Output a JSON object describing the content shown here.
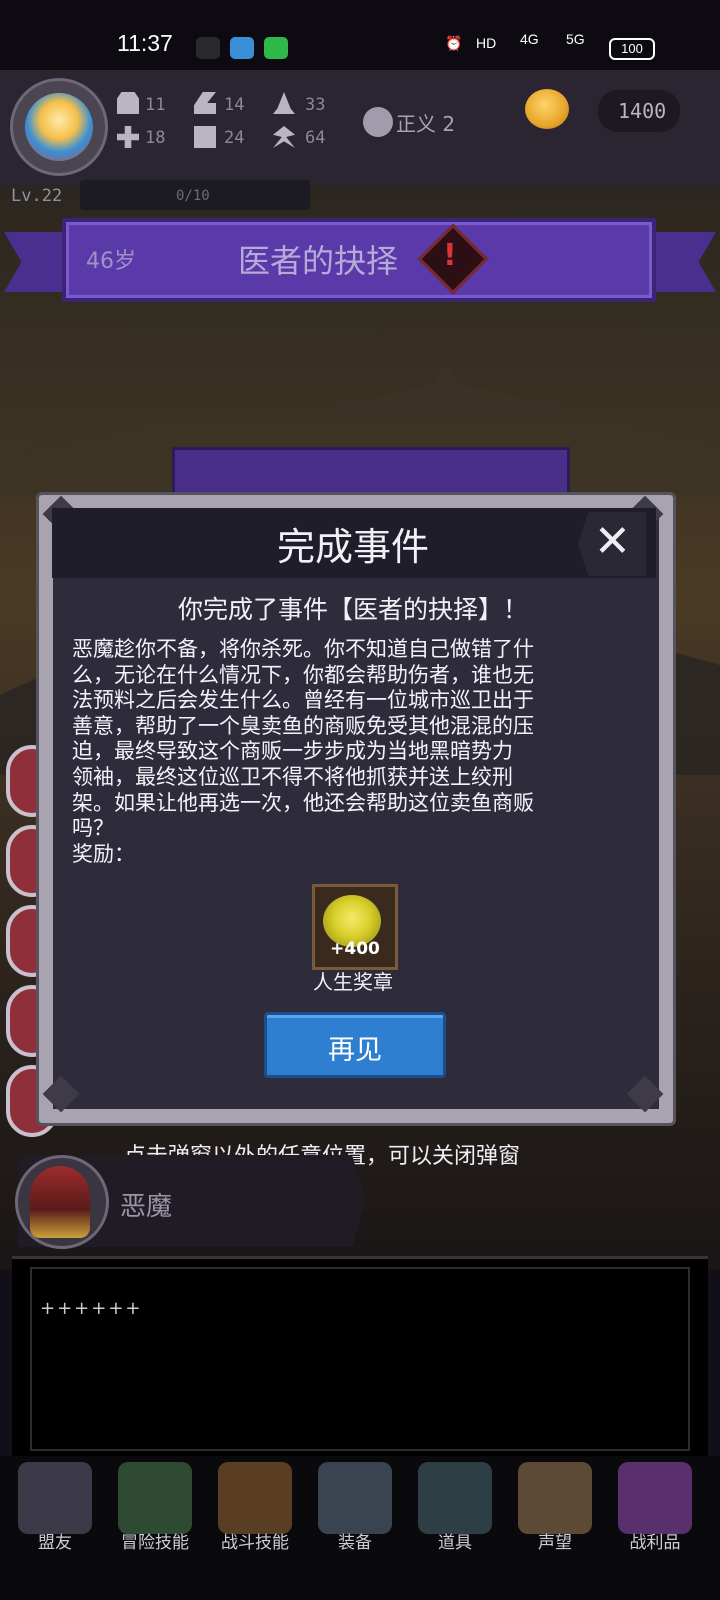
{
  "status_bar": {
    "time": "11:37",
    "network": "HD",
    "signal_1": "4G",
    "signal_2": "5G",
    "battery": "100"
  },
  "player": {
    "stats": [
      {
        "icon": "fist-icon",
        "value": "11"
      },
      {
        "icon": "boot-icon",
        "value": "14"
      },
      {
        "icon": "wizard-hat-icon",
        "value": "33"
      },
      {
        "icon": "clover-icon",
        "value": "18"
      },
      {
        "icon": "book-icon",
        "value": "24"
      },
      {
        "icon": "leaf-icon",
        "value": "64"
      }
    ],
    "alignment": "正义 2",
    "coins": "1400",
    "level": "Lv.22",
    "xp": "0/10"
  },
  "event_banner": {
    "age": "46岁",
    "title": "医者的抉择"
  },
  "modal": {
    "title": "完成事件",
    "subtitle": "你完成了事件【医者的抉择】！",
    "body_lines": [
      "恶魔趁你不备，将你杀死。你不知道自己做错了什",
      "么，无论在什么情况下，你都会帮助伤者，谁也无",
      "法预料之后会发生什么。曾经有一位城市巡卫出于",
      "善意，帮助了一个臭卖鱼的商贩免受其他混混的压",
      "迫，最终导致这个商贩一步步成为当地黑暗势力",
      "领袖，最终这位巡卫不得不将他抓获并送上绞刑",
      "架。如果让他再选一次，他还会帮助这位卖鱼商贩",
      "吗？",
      "奖励："
    ],
    "reward": {
      "amount": "+400",
      "name": "人生奖章"
    },
    "button": "再见"
  },
  "hint": "点击弹窗以外的任意位置，可以关闭弹窗",
  "npc": {
    "name": "恶魔"
  },
  "log": {
    "text": "++++++"
  },
  "nav": [
    {
      "label": "盟友",
      "icon": "handshake-icon",
      "color": "#3c3a48"
    },
    {
      "label": "冒险技能",
      "icon": "skill-book-icon",
      "color": "#2f4a32"
    },
    {
      "label": "战斗技能",
      "icon": "backpack-icon",
      "color": "#5a3e24"
    },
    {
      "label": "装备",
      "icon": "crossed-swords-icon",
      "color": "#3a4450"
    },
    {
      "label": "道具",
      "icon": "amulet-icon",
      "color": "#2d3f45"
    },
    {
      "label": "声望",
      "icon": "scroll-icon",
      "color": "#5c4a34"
    },
    {
      "label": "战利品",
      "icon": "treasure-chest-icon",
      "color": "#5a2f6e"
    }
  ]
}
